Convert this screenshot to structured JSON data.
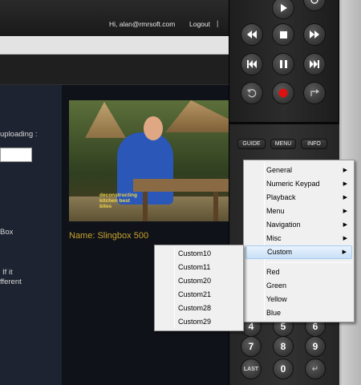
{
  "header": {
    "user": "Hi, alan@rmrsoft.com",
    "logout": "Logout",
    "separator": "|"
  },
  "left_panel": {
    "text_uploading": "uploading :",
    "text_box": "Box",
    "text_if_it": "If it",
    "text_fferent": "fferent"
  },
  "main": {
    "device_name": "Name: Slingbox 500",
    "video_logo": "deconstructing kitchen best bites"
  },
  "remote": {
    "pills": [
      "GUIDE",
      "MENU",
      "INFO"
    ],
    "keypad": [
      "4",
      "5",
      "6",
      "7",
      "8",
      "9",
      "LAST",
      "0",
      "↵"
    ]
  },
  "context_menu": {
    "items": [
      {
        "label": "General",
        "submenu": true
      },
      {
        "label": "Numeric Keypad",
        "submenu": true
      },
      {
        "label": "Playback",
        "submenu": true
      },
      {
        "label": "Menu",
        "submenu": true
      },
      {
        "label": "Navigation",
        "submenu": true
      },
      {
        "label": "Misc",
        "submenu": true
      },
      {
        "label": "Custom",
        "submenu": true,
        "selected": true
      }
    ],
    "color_items": [
      "Red",
      "Green",
      "Yellow",
      "Blue"
    ],
    "submenu_arrow": "▶"
  },
  "custom_submenu": {
    "items": [
      "Custom10",
      "Custom11",
      "Custom20",
      "Custom21",
      "Custom28",
      "Custom29"
    ]
  },
  "colors": {
    "accent_name": "#c9a22e",
    "record": "#e01010",
    "selection": "#c9e0f8"
  }
}
